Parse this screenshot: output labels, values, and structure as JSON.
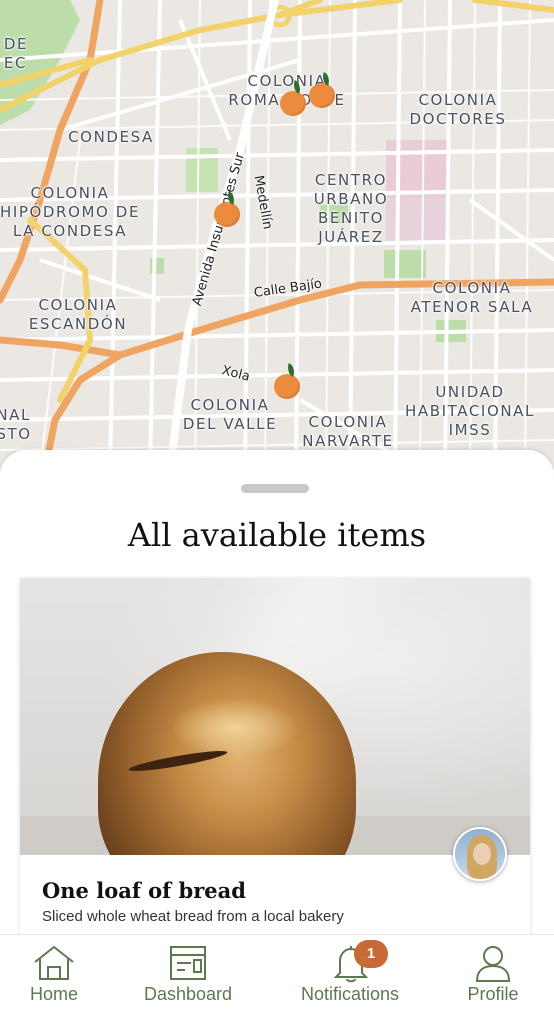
{
  "map": {
    "neighborhoods": [
      {
        "id": "colonia-roma-norte",
        "text": "COLONIA\nROMA NORTE"
      },
      {
        "id": "colonia-doctores",
        "text": "COLONIA\nDOCTORES"
      },
      {
        "id": "condesa",
        "text": "CONDESA"
      },
      {
        "id": "colonia-hipodromo",
        "text": "COLONIA\nHIPÓDROMO DE\nLA CONDESA"
      },
      {
        "id": "centro-urbano",
        "text": "CENTRO\nURBANO\nBENITO\nJUÁREZ"
      },
      {
        "id": "colonia-escandon",
        "text": "COLONIA\nESCANDÓN"
      },
      {
        "id": "colonia-atenor-sala",
        "text": "COLONIA\nATENOR SALA"
      },
      {
        "id": "colonia-del-valle",
        "text": "COLONIA\nDEL VALLE"
      },
      {
        "id": "colonia-narvarte",
        "text": "COLONIA\nNARVARTE"
      },
      {
        "id": "unidad-habitacional",
        "text": "UNIDAD\nHABITACIONAL\nIMSS"
      },
      {
        "id": "de-tec",
        "text": "DE\nEC"
      },
      {
        "id": "nal-sto",
        "text": "NAL\nSTO"
      }
    ],
    "streets": [
      {
        "id": "avenida-insurgentes",
        "text": "Avenida Insurgentes Sur"
      },
      {
        "id": "medellin",
        "text": "Medellín"
      },
      {
        "id": "calle-bajio",
        "text": "Calle Bajío"
      },
      {
        "id": "xola",
        "text": "Xola"
      }
    ],
    "marker_count": 4
  },
  "sheet": {
    "title": "All available items"
  },
  "item": {
    "name": "One loaf of bread",
    "description": "Sliced whole wheat bread from a local bakery"
  },
  "tabs": [
    {
      "label": "Home",
      "icon": "home-icon"
    },
    {
      "label": "Dashboard",
      "icon": "dashboard-icon"
    },
    {
      "label": "Notifications",
      "icon": "bell-icon"
    },
    {
      "label": "Profile",
      "icon": "profile-icon"
    }
  ],
  "notifications_badge": "1",
  "colors": {
    "accent_green": "#5d7a4d",
    "badge_orange": "#c86a35",
    "marker_orange": "#ec8b3e",
    "major_road": "#f0a462",
    "highway_yellow": "#f2d36b",
    "park_green": "#bcdcaa"
  }
}
